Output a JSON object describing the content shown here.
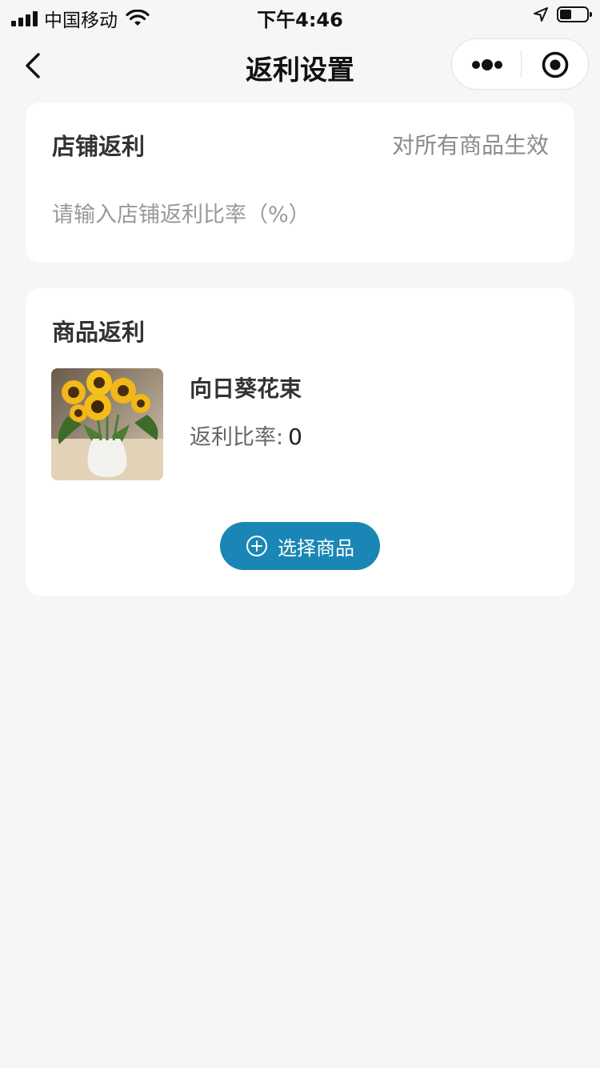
{
  "status_bar": {
    "carrier": "中国移动",
    "time": "下午4:46",
    "battery_level": 0.45
  },
  "nav": {
    "title": "返利设置",
    "icons": {
      "back": "chevron-left-icon",
      "more": "more-dots-icon",
      "close": "target-circle-icon"
    }
  },
  "store_rebate": {
    "title": "店铺返利",
    "hint": "对所有商品生效",
    "input_value": "",
    "input_placeholder": "请输入店铺返利比率（%）"
  },
  "goods_rebate": {
    "title": "商品返利",
    "items": [
      {
        "name": "向日葵花束",
        "rate_label": "返利比率:",
        "rate_value": "0",
        "image": "sunflower-bouquet-photo"
      }
    ],
    "select_button_label": "选择商品",
    "select_button_icon": "plus-circle-icon"
  },
  "colors": {
    "background": "#f6f6f6",
    "card": "#ffffff",
    "accent": "#1a86b5",
    "hint_text": "#8a8a8a"
  }
}
